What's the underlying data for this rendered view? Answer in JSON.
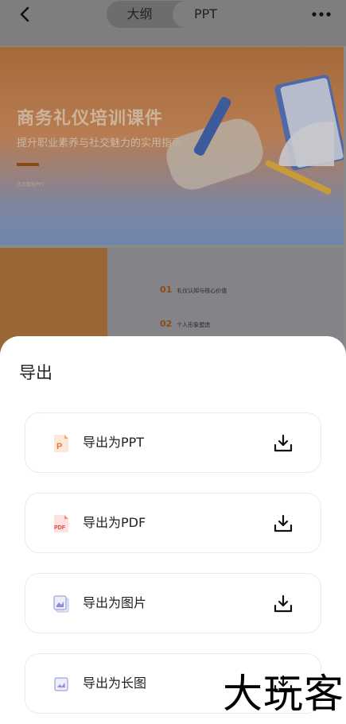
{
  "header": {
    "tab_outline": "大纲",
    "tab_ppt": "PPT"
  },
  "slide1": {
    "title": "商务礼仪培训课件",
    "subtitle": "提升职业素养与社交魅力的实用指南",
    "small": "讯文智能PPT"
  },
  "slide2": {
    "items": [
      {
        "num": "01",
        "text": "礼仪认知与核心价值"
      },
      {
        "num": "02",
        "text": "个人形象塑造"
      }
    ]
  },
  "sheet": {
    "title": "导出",
    "options": [
      {
        "label": "导出为PPT",
        "icon": "ppt-file-icon"
      },
      {
        "label": "导出为PDF",
        "icon": "pdf-file-icon"
      },
      {
        "label": "导出为图片",
        "icon": "images-icon"
      },
      {
        "label": "导出为长图",
        "icon": "long-image-icon"
      }
    ]
  },
  "watermark": "大玩客",
  "colors": {
    "accent_orange": "#e8743a",
    "pdf_red": "#e0443c",
    "image_purple": "#8c8fd8"
  }
}
